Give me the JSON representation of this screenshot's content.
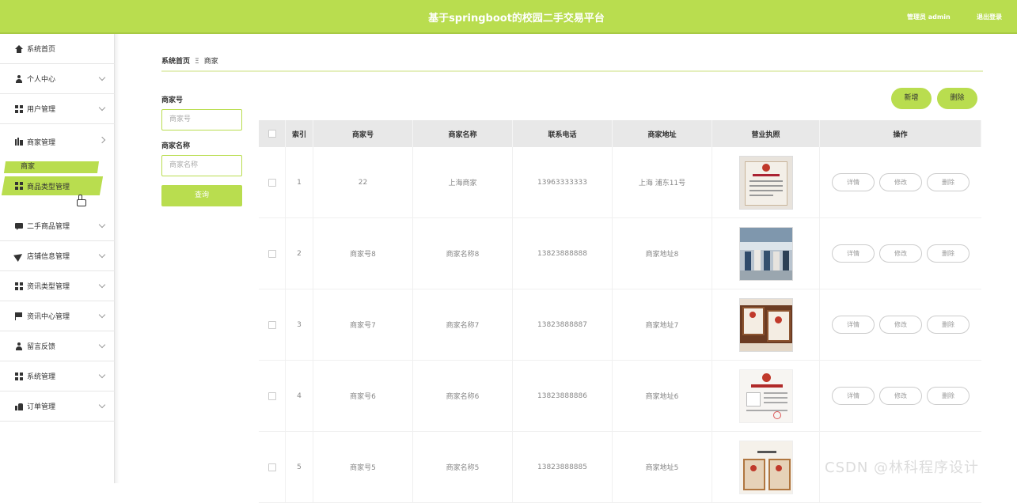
{
  "header": {
    "title": "基于springboot的校园二手交易平台",
    "user": "管理员 admin",
    "logout": "退出登录"
  },
  "sidebar": {
    "items": [
      {
        "label": "系统首页",
        "icon": "home-icon"
      },
      {
        "label": "个人中心",
        "icon": "user-icon"
      },
      {
        "label": "用户管理",
        "icon": "grid-icon"
      },
      {
        "label": "商家管理",
        "icon": "bar-chart-icon"
      },
      {
        "label": "商品类型管理",
        "icon": "grid-icon"
      },
      {
        "label": "二手商品管理",
        "icon": "chat-icon"
      },
      {
        "label": "店铺信息管理",
        "icon": "send-icon"
      },
      {
        "label": "资讯类型管理",
        "icon": "grid-icon"
      },
      {
        "label": "资讯中心管理",
        "icon": "flag-icon"
      },
      {
        "label": "留言反馈",
        "icon": "user-icon"
      },
      {
        "label": "系统管理",
        "icon": "grid-icon"
      },
      {
        "label": "订单管理",
        "icon": "thumbs-up-icon"
      }
    ],
    "sub_item": "商家",
    "accent": "#b9dd4f"
  },
  "breadcrumb": {
    "home": "系统首页",
    "separator": "Ξ",
    "current": "商家"
  },
  "search": {
    "field1_label": "商家号",
    "field1_placeholder": "商家号",
    "field2_label": "商家名称",
    "field2_placeholder": "商家名称",
    "button": "查询"
  },
  "toolbar": {
    "add": "新增",
    "delete": "删除"
  },
  "table": {
    "headers": [
      "索引",
      "商家号",
      "商家名称",
      "联系电话",
      "商家地址",
      "营业执照",
      "操作"
    ],
    "rows": [
      {
        "index": "1",
        "code": "22",
        "name": "上海商家",
        "phone": "13963333333",
        "address": "上海 浦东11号"
      },
      {
        "index": "2",
        "code": "商家号8",
        "name": "商家名称8",
        "phone": "13823888888",
        "address": "商家地址8"
      },
      {
        "index": "3",
        "code": "商家号7",
        "name": "商家名称7",
        "phone": "13823888887",
        "address": "商家地址7"
      },
      {
        "index": "4",
        "code": "商家号6",
        "name": "商家名称6",
        "phone": "13823888886",
        "address": "商家地址6"
      },
      {
        "index": "5",
        "code": "商家号5",
        "name": "商家名称5",
        "phone": "13823888885",
        "address": "商家地址5"
      }
    ],
    "actions": {
      "detail": "详情",
      "edit": "修改",
      "delete": "删除"
    }
  },
  "watermark": "CSDN @林科程序设计"
}
